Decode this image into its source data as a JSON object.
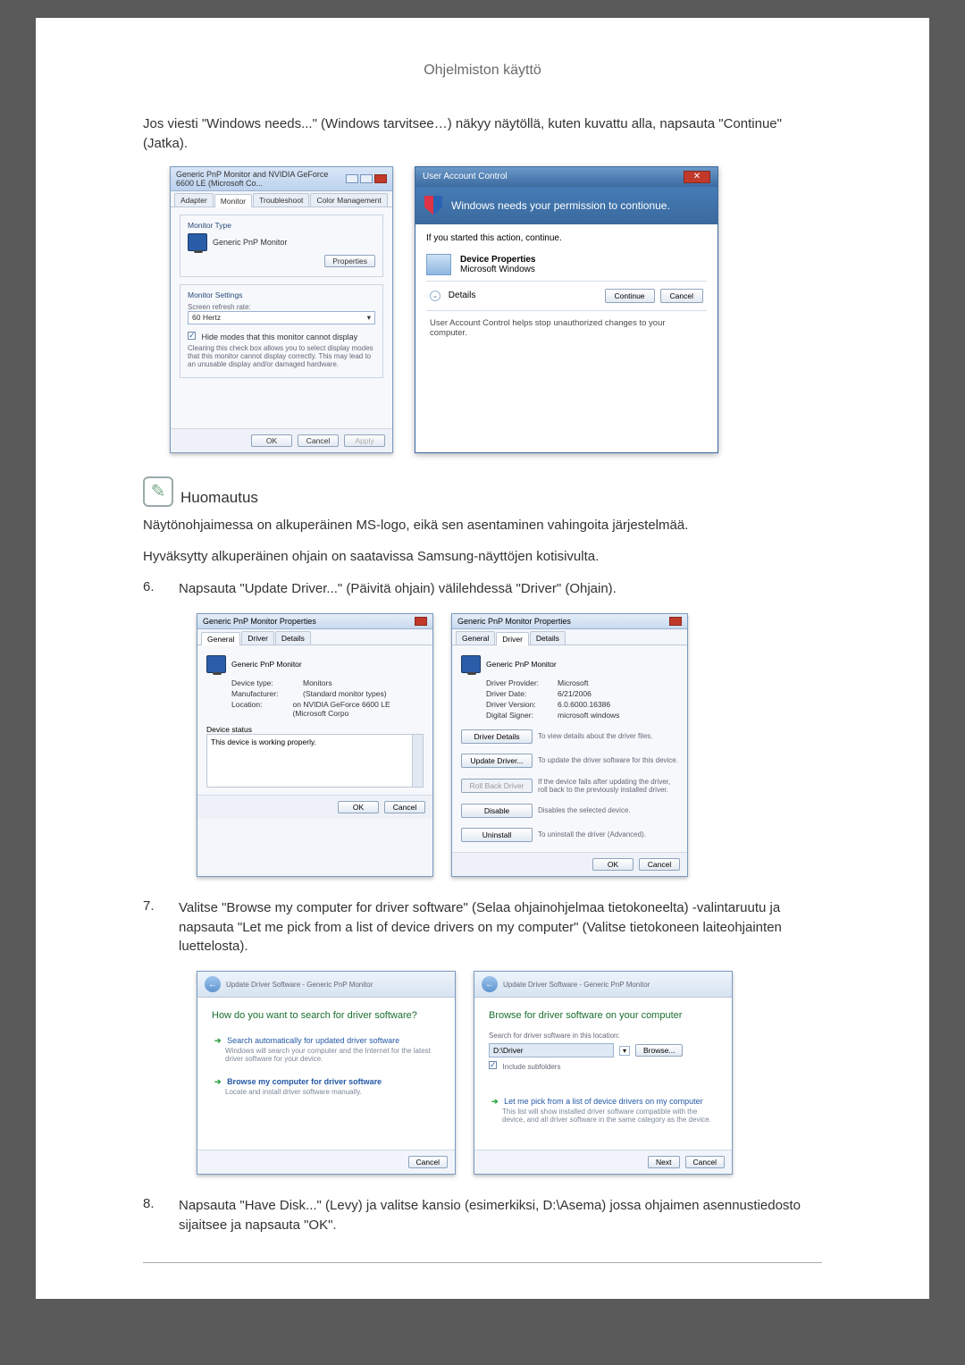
{
  "page_title": "Ohjelmiston käyttö",
  "intro_text": "Jos viesti \"Windows needs...\" (Windows tarvitsee…) näkyy näytöllä, kuten kuvattu alla, napsauta \"Continue\" (Jatka).",
  "monitor_dialog": {
    "title": "Generic PnP Monitor and NVIDIA GeForce 6600 LE (Microsoft Co...",
    "tabs": [
      "Adapter",
      "Monitor",
      "Troubleshoot",
      "Color Management"
    ],
    "active_tab": 1,
    "monitor_type_label": "Monitor Type",
    "monitor_name": "Generic PnP Monitor",
    "properties_btn": "Properties",
    "settings_label": "Monitor Settings",
    "refresh_rate_label": "Screen refresh rate:",
    "refresh_rate_value": "60 Hertz",
    "hide_modes_label": "Hide modes that this monitor cannot display",
    "hide_modes_note": "Clearing this check box allows you to select display modes that this monitor cannot display correctly. This may lead to an unusable display and/or damaged hardware.",
    "ok": "OK",
    "cancel": "Cancel",
    "apply": "Apply"
  },
  "uac": {
    "title": "User Account Control",
    "heading": "Windows needs your permission to contionue.",
    "subtext": "If you started this action, continue.",
    "app_name": "Device Properties",
    "publisher": "Microsoft Windows",
    "details": "Details",
    "continue": "Continue",
    "cancel": "Cancel",
    "footer": "User Account Control helps stop unauthorized changes to your computer."
  },
  "note_title": "Huomautus",
  "note_p1": "Näytönohjaimessa on alkuperäinen MS-logo, eikä sen asentaminen vahingoita järjestelmää.",
  "note_p2": "Hyväksytty alkuperäinen ohjain on saatavissa Samsung-näyttöjen kotisivulta.",
  "step6": "Napsauta \"Update Driver...\" (Päivitä ohjain) välilehdessä \"Driver\" (Ohjain).",
  "props_general": {
    "title": "Generic PnP Monitor Properties",
    "tabs": [
      "General",
      "Driver",
      "Details"
    ],
    "device_name": "Generic PnP Monitor",
    "device_type_k": "Device type:",
    "device_type_v": "Monitors",
    "manufacturer_k": "Manufacturer:",
    "manufacturer_v": "(Standard monitor types)",
    "location_k": "Location:",
    "location_v": "on NVIDIA GeForce 6600 LE (Microsoft Corpo",
    "status_label": "Device status",
    "status_text": "This device is working properly.",
    "ok": "OK",
    "cancel": "Cancel"
  },
  "props_driver": {
    "title": "Generic PnP Monitor Properties",
    "device_name": "Generic PnP Monitor",
    "provider_k": "Driver Provider:",
    "provider_v": "Microsoft",
    "date_k": "Driver Date:",
    "date_v": "6/21/2006",
    "version_k": "Driver Version:",
    "version_v": "6.0.6000.16386",
    "signer_k": "Digital Signer:",
    "signer_v": "microsoft windows",
    "btn_details": "Driver Details",
    "btn_details_desc": "To view details about the driver files.",
    "btn_update": "Update Driver...",
    "btn_update_desc": "To update the driver software for this device.",
    "btn_rollback": "Roll Back Driver",
    "btn_rollback_desc": "If the device fails after updating the driver, roll back to the previously installed driver.",
    "btn_disable": "Disable",
    "btn_disable_desc": "Disables the selected device.",
    "btn_uninstall": "Uninstall",
    "btn_uninstall_desc": "To uninstall the driver (Advanced).",
    "ok": "OK",
    "cancel": "Cancel"
  },
  "step7": "Valitse \"Browse my computer for driver software\" (Selaa ohjainohjelmaa tietokoneelta) -valintaruutu ja napsauta \"Let me pick from a list of device drivers on my computer\" (Valitse tietokoneen laiteohjainten luettelosta).",
  "wizard1": {
    "breadcrumb": "Update Driver Software - Generic PnP Monitor",
    "heading": "How do you want to search for driver software?",
    "opt1_main": "Search automatically for updated driver software",
    "opt1_sub": "Windows will search your computer and the Internet for the latest driver software for your device.",
    "opt2_main": "Browse my computer for driver software",
    "opt2_sub": "Locate and install driver software manually.",
    "cancel": "Cancel"
  },
  "wizard2": {
    "breadcrumb": "Update Driver Software - Generic PnP Monitor",
    "heading": "Browse for driver software on your computer",
    "search_label": "Search for driver software in this location:",
    "path": "D:\\Driver",
    "browse": "Browse...",
    "include_sub": "Include subfolders",
    "opt_main": "Let me pick from a list of device drivers on my computer",
    "opt_sub": "This list will show installed driver software compatible with the device, and all driver software in the same category as the device.",
    "next": "Next",
    "cancel": "Cancel"
  },
  "step8": "Napsauta \"Have Disk...\" (Levy) ja valitse kansio (esimerkiksi, D:\\Asema) jossa ohjaimen asennustiedosto sijaitsee ja napsauta \"OK\"."
}
